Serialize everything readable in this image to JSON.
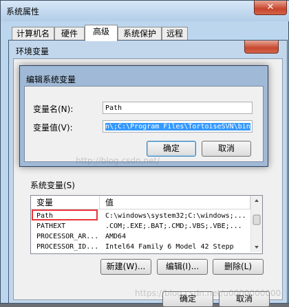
{
  "system_properties": {
    "title": "系统属性",
    "close_glyph": "✕",
    "tabs": [
      "计算机名",
      "硬件",
      "高级",
      "系统保护",
      "远程"
    ]
  },
  "env_vars_dialog": {
    "title": "环境变量",
    "system_vars_label": "系统变量(S)",
    "columns": [
      "变量",
      "值"
    ],
    "rows": [
      {
        "name": "Path",
        "value": "C:\\windows\\system32;C:\\windows;..."
      },
      {
        "name": "PATHEXT",
        "value": ".COM;.EXE;.BAT;.CMD;.VBS;.VBE;..."
      },
      {
        "name": "PROCESSOR_AR...",
        "value": "AMD64"
      },
      {
        "name": "PROCESSOR_ID...",
        "value": "Intel64 Family 6 Model 42 Stepp"
      }
    ],
    "buttons": {
      "new": "新建(W)...",
      "edit": "编辑(I)...",
      "delete": "删除(L)"
    },
    "ok": "确定",
    "cancel": "取消"
  },
  "edit_dialog": {
    "title": "编辑系统变量",
    "name_label": "变量名(N):",
    "name_value": "Path",
    "value_label": "变量值(V):",
    "value_value": "n\\;C:\\Program Files\\TortoiseSVN\\bin",
    "ok": "确定",
    "cancel": "取消"
  },
  "watermark": {
    "top": "http://blog.csdn.net/",
    "bottom": "https://blog.csdn.net/u0000000000"
  },
  "colors": {
    "highlight_box": "#e8353a",
    "selection": "#3399ff"
  }
}
